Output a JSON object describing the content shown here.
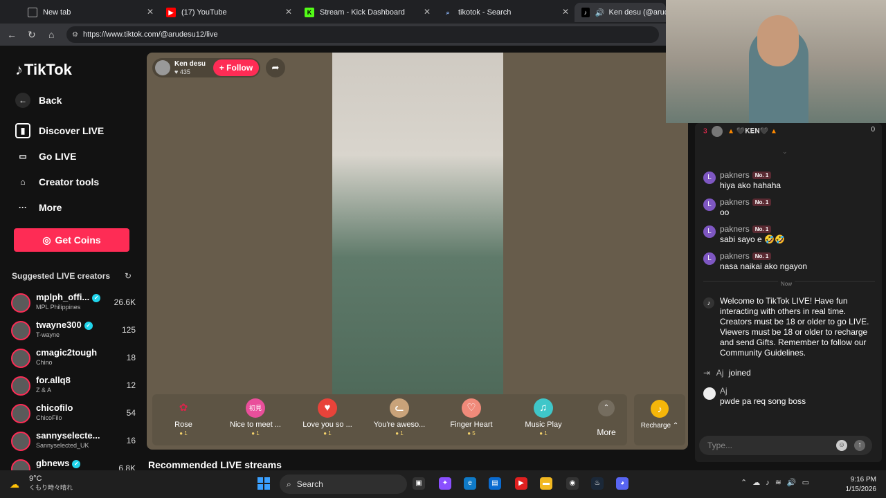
{
  "browser": {
    "tabs": [
      {
        "title": "New tab",
        "icon": "newtab-icon"
      },
      {
        "title": "(17) YouTube",
        "icon": "youtube-icon"
      },
      {
        "title": "Stream - Kick Dashboard",
        "icon": "kick-icon"
      },
      {
        "title": "tikotok - Search",
        "icon": "search-icon"
      },
      {
        "title": "Ken desu (@arudes",
        "icon": "tiktok-icon"
      }
    ],
    "url": "https://www.tiktok.com/@arudesu12/live"
  },
  "sidebar": {
    "logo": "TikTok",
    "back": "Back",
    "items": [
      {
        "label": "Discover LIVE",
        "icon": "discover-live-icon"
      },
      {
        "label": "Go LIVE",
        "icon": "camera-icon"
      },
      {
        "label": "Creator tools",
        "icon": "creator-tools-icon"
      },
      {
        "label": "More",
        "icon": "more-icon"
      }
    ],
    "get_coins": "Get Coins",
    "suggested_title": "Suggested LIVE creators",
    "creators": [
      {
        "name": "mplph_offi...",
        "sub": "MPL Philippines",
        "count": "26.6K",
        "verified": true
      },
      {
        "name": "twayne300",
        "sub": "T-wayne",
        "count": "125",
        "verified": true
      },
      {
        "name": "cmagic2tough",
        "sub": "Chino",
        "count": "18",
        "verified": false
      },
      {
        "name": "for.allq8",
        "sub": "Z & A",
        "count": "12",
        "verified": false
      },
      {
        "name": "chicofilo",
        "sub": "ChicoFilo",
        "count": "54",
        "verified": false
      },
      {
        "name": "sannyselecte...",
        "sub": "Sannyselected_UK",
        "count": "16",
        "verified": false
      },
      {
        "name": "gbnews",
        "sub": "",
        "count": "6.8K",
        "verified": true
      }
    ]
  },
  "stream": {
    "host": "Ken desu",
    "likes": "435",
    "follow": "+ Follow",
    "gifts": [
      {
        "name": "Rose",
        "price": "1",
        "icon": "rose-icon",
        "color": "#d6264a"
      },
      {
        "name": "Nice to meet ...",
        "price": "1",
        "icon": "nice-to-meet-icon",
        "color": "#e94f9b"
      },
      {
        "name": "Love you so ...",
        "price": "1",
        "icon": "heart-icon",
        "color": "#e8433a"
      },
      {
        "name": "You're aweso...",
        "price": "1",
        "icon": "cat-icon",
        "color": "#c9a37a"
      },
      {
        "name": "Finger Heart",
        "price": "5",
        "icon": "finger-heart-icon",
        "color": "#f08a7a"
      },
      {
        "name": "Music Play",
        "price": "1",
        "icon": "music-icon",
        "color": "#3fc6c9"
      }
    ],
    "more": "More",
    "recharge": "Recharge",
    "recommended": "Recommended LIVE streams"
  },
  "chat": {
    "rank": {
      "position": "3",
      "name": "🖤𝐊𝐄𝐍🖤",
      "score": "0"
    },
    "messages": [
      {
        "user": "pakners",
        "badge": "No. 1",
        "text": "hiya ako hahaha"
      },
      {
        "user": "pakners",
        "badge": "No. 1",
        "text": "oo"
      },
      {
        "user": "pakners",
        "badge": "No. 1",
        "text": "sabi sayo e 🤣🤣"
      },
      {
        "user": "pakners",
        "badge": "No. 1",
        "text": "nasa naikai ako ngayon"
      }
    ],
    "now": "Now",
    "welcome": "Welcome to TikTok LIVE! Have fun interacting with others in real time. Creators must be 18 or older to go LIVE. Viewers must be 18 or older to recharge and send Gifts. Remember to follow our Community Guidelines.",
    "joined_user": "Aj",
    "joined_text": "joined",
    "last_user": "Aj",
    "last_text": "pwde pa req song boss",
    "input_placeholder": "Type..."
  },
  "taskbar": {
    "temp": "9°C",
    "weather_text": "くもり時々晴れ",
    "search": "Search",
    "time": "9:16 PM",
    "date": "1/15/2026"
  }
}
